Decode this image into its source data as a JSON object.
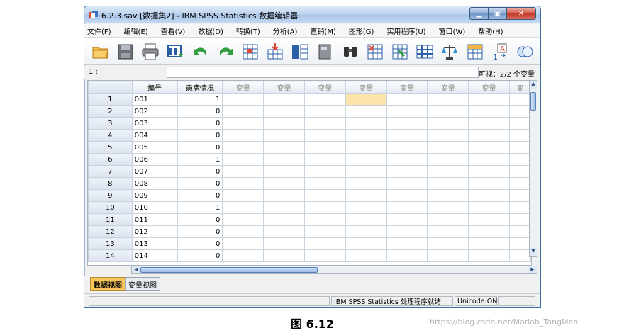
{
  "window": {
    "title": "6.2.3.sav [数据集2] - IBM SPSS Statistics 数据编辑器",
    "minimize_label": "▁",
    "maximize_label": "▣",
    "close_label": "✕"
  },
  "menu": [
    "文件(F)",
    "编辑(E)",
    "查看(V)",
    "数据(D)",
    "转换(T)",
    "分析(A)",
    "直销(M)",
    "图形(G)",
    "实用程序(U)",
    "窗口(W)",
    "帮助(H)"
  ],
  "toolbar_icons": [
    "open-folder-icon",
    "save-icon",
    "print-icon",
    "dialog-recall-icon",
    "undo-icon",
    "redo-icon",
    "goto-case-icon",
    "goto-variable-icon",
    "variables-icon",
    "run-descriptives-icon",
    "find-icon",
    "insert-cases-icon",
    "insert-variable-icon",
    "split-file-icon",
    "weight-cases-icon",
    "select-cases-icon",
    "value-labels-icon",
    "use-sets-icon"
  ],
  "cellbar": {
    "cell_ref": "1 :",
    "visible": "可视：2/2 个变量"
  },
  "grid": {
    "columns": [
      "编号",
      "患病情况",
      "变量",
      "变量",
      "变量",
      "变量",
      "变量",
      "变量",
      "变量",
      "变"
    ],
    "rows": [
      {
        "n": "1",
        "id": "001",
        "status": "1"
      },
      {
        "n": "2",
        "id": "002",
        "status": "0"
      },
      {
        "n": "3",
        "id": "003",
        "status": "0"
      },
      {
        "n": "4",
        "id": "004",
        "status": "0"
      },
      {
        "n": "5",
        "id": "005",
        "status": "0"
      },
      {
        "n": "6",
        "id": "006",
        "status": "1"
      },
      {
        "n": "7",
        "id": "007",
        "status": "0"
      },
      {
        "n": "8",
        "id": "008",
        "status": "0"
      },
      {
        "n": "9",
        "id": "009",
        "status": "0"
      },
      {
        "n": "10",
        "id": "010",
        "status": "1"
      },
      {
        "n": "11",
        "id": "011",
        "status": "0"
      },
      {
        "n": "12",
        "id": "012",
        "status": "0"
      },
      {
        "n": "13",
        "id": "013",
        "status": "0"
      },
      {
        "n": "14",
        "id": "014",
        "status": "0"
      }
    ],
    "selected_cell": {
      "row": 1,
      "col": 6
    }
  },
  "tabs": {
    "data_view": "数据视图",
    "variable_view": "变量视图"
  },
  "status": {
    "processor": "IBM SPSS Statistics 处理程序就绪",
    "unicode": "Unicode:ON"
  },
  "caption": "图 6.12",
  "watermark": "https://blog.csdn.net/Matlab_TangMen",
  "colors": {
    "selected_cell": "#fbe3a9",
    "active_tab": "#f7c65a",
    "titlebar": "#bcd2ee"
  }
}
